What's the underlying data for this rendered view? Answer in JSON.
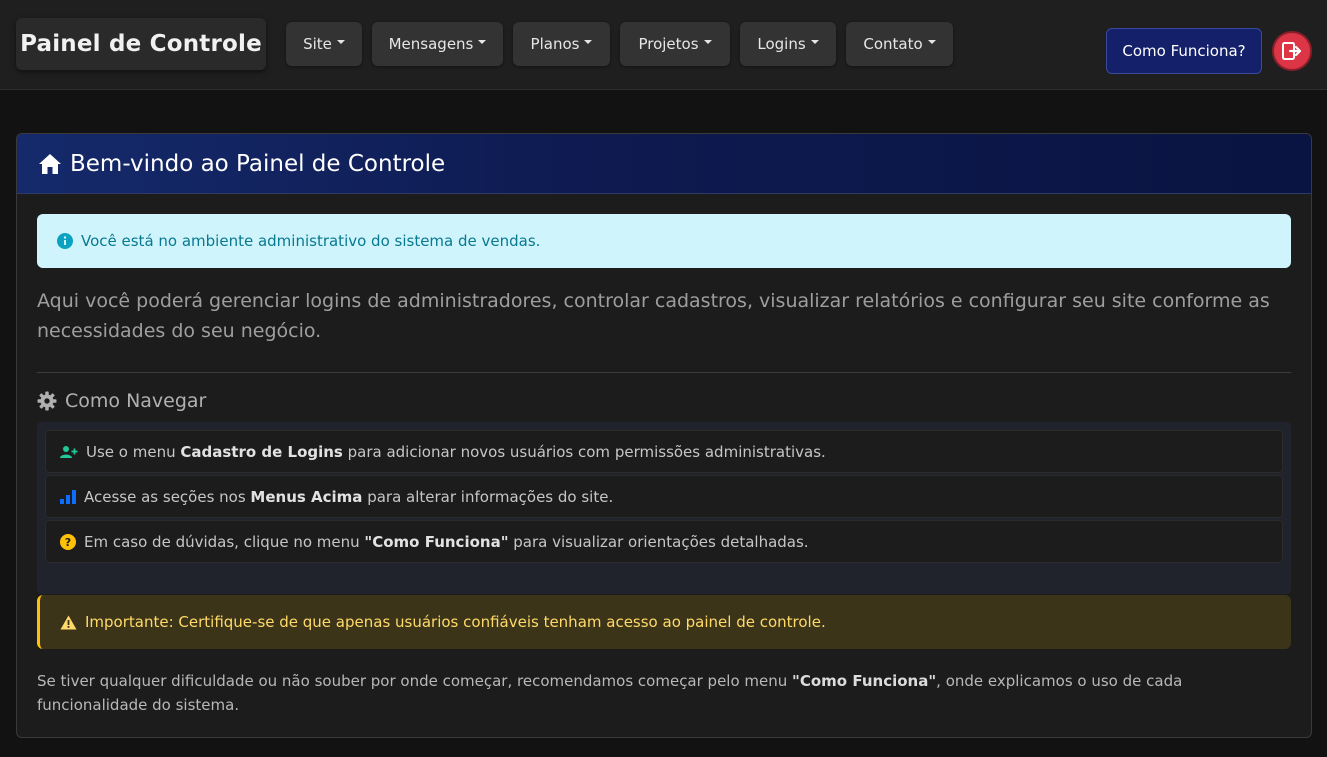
{
  "header": {
    "brand": "Painel de Controle",
    "menus": [
      {
        "label": "Site"
      },
      {
        "label": "Mensagens"
      },
      {
        "label": "Planos"
      },
      {
        "label": "Projetos"
      },
      {
        "label": "Logins"
      },
      {
        "label": "Contato"
      }
    ],
    "help_button": "Como Funciona?",
    "logout_icon": "logout-icon"
  },
  "card": {
    "title": "Bem-vindo ao Painel de Controle",
    "title_icon": "home-icon",
    "info_alert": "Você está no ambiente administrativo do sistema de vendas.",
    "lead": "Aqui você poderá gerenciar logins de administradores, controlar cadastros, visualizar relatórios e configurar seu site conforme as necessidades do seu negócio.",
    "section_title": "Como Navegar",
    "navigation_items": [
      {
        "icon": "user-plus-icon",
        "prefix": "Use o menu ",
        "bold": "Cadastro de Logins",
        "suffix": " para adicionar novos usuários com permissões administrativas."
      },
      {
        "icon": "bar-chart-icon",
        "prefix": "Acesse as seções nos ",
        "bold": "Menus Acima",
        "suffix": " para alterar informações do site."
      },
      {
        "icon": "question-circle-icon",
        "prefix": "Em caso de dúvidas, clique no menu ",
        "bold": "\"Como Funciona\"",
        "suffix": " para visualizar orientações detalhadas."
      }
    ],
    "warning_alert": "Importante: Certifique-se de que apenas usuários confiáveis tenham acesso ao painel de controle.",
    "footer": {
      "prefix": "Se tiver qualquer dificuldade ou não souber por onde começar, recomendamos começar pelo menu ",
      "bold": "\"Como Funciona\"",
      "suffix": ", onde explicamos o uso de cada funcionalidade do sistema."
    }
  },
  "colors": {
    "background": "#121212",
    "header_gradient": "#152a6b",
    "info_bg": "#cff4fc",
    "warning_accent": "#ffc107",
    "danger": "#dc3545",
    "success": "#20c997",
    "primary": "#0d6efd"
  }
}
